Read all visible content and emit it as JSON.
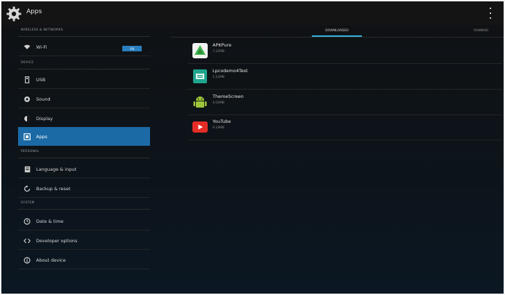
{
  "actionbar": {
    "title": "Apps",
    "app_icon": "settings-gear-icon",
    "overflow_icon": "overflow-menu-icon"
  },
  "sidebar": {
    "sections": [
      {
        "header": "WIRELESS & NETWORKS"
      },
      {
        "header": "DEVICE"
      },
      {
        "header": "PERSONAL"
      },
      {
        "header": "SYSTEM"
      }
    ],
    "items": [
      {
        "label": "Wi-Fi",
        "icon": "wifi-icon"
      },
      {
        "label": "USB",
        "icon": "usb-icon"
      },
      {
        "label": "Sound",
        "icon": "sound-icon"
      },
      {
        "label": "Display",
        "icon": "display-icon"
      },
      {
        "label": "Apps",
        "icon": "apps-icon",
        "active": true
      },
      {
        "label": "Language & input",
        "icon": "language-icon"
      },
      {
        "label": "Backup & reset",
        "icon": "backup-icon"
      },
      {
        "label": "Date & time",
        "icon": "clock-icon"
      },
      {
        "label": "Developer options",
        "icon": "developer-icon"
      },
      {
        "label": "About device",
        "icon": "info-icon"
      }
    ],
    "wifi_toggle": "ON"
  },
  "tabs": [
    {
      "label": "DOWNLOADED",
      "active": true
    },
    {
      "label": "RUNNING",
      "active": false
    }
  ],
  "apps": [
    {
      "name": "APKPure",
      "size": "7.22MB",
      "icon": "apkpure-icon"
    },
    {
      "name": "Lpcodemo4Test",
      "size": "1.12MB",
      "icon": "lpcodemo-icon"
    },
    {
      "name": "ThemeScreen",
      "size": "4.02MB",
      "icon": "android-icon"
    },
    {
      "name": "YouTube",
      "size": "9.18MB",
      "icon": "youtube-icon"
    }
  ],
  "colors": {
    "accent": "#1b6aa6",
    "tab_indicator": "#33b5e5",
    "background": "#0d1318"
  }
}
